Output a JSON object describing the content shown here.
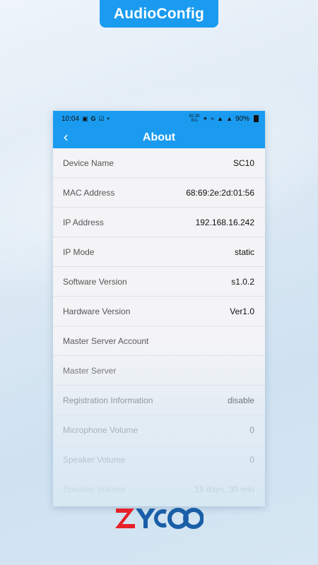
{
  "badge": {
    "label": "AudioConfig"
  },
  "status_bar": {
    "time": "10:04",
    "left_icons": [
      "gallery-icon",
      "google-icon",
      "check-icon",
      "dot-icon"
    ],
    "speed": "92.30\nK/s",
    "battery_text": "90%"
  },
  "header": {
    "title": "About",
    "back_icon": "chevron-left-icon"
  },
  "rows": [
    {
      "label": "Device Name",
      "value": "SC10"
    },
    {
      "label": "MAC Address",
      "value": "68:69:2e:2d:01:56"
    },
    {
      "label": "IP Address",
      "value": "192.168.16.242"
    },
    {
      "label": "IP Mode",
      "value": "static"
    },
    {
      "label": "Software Version",
      "value": "s1.0.2"
    },
    {
      "label": "Hardware Version",
      "value": "Ver1.0"
    },
    {
      "label": "Master Server Account",
      "value": ""
    },
    {
      "label": "Master Server",
      "value": ""
    },
    {
      "label": "Registration Information",
      "value": "disable"
    },
    {
      "label": "Microphone Volume",
      "value": "0"
    },
    {
      "label": "Speaker Volume",
      "value": "0"
    },
    {
      "label": "Speaker Volume",
      "value": "15 days, 30 min"
    }
  ],
  "logo": {
    "text": "ZYCOO",
    "colors": {
      "z": "#e62129",
      "rest": "#1a5fa8"
    }
  },
  "colors": {
    "accent": "#1a9bf0",
    "background": "#dce9f4"
  }
}
